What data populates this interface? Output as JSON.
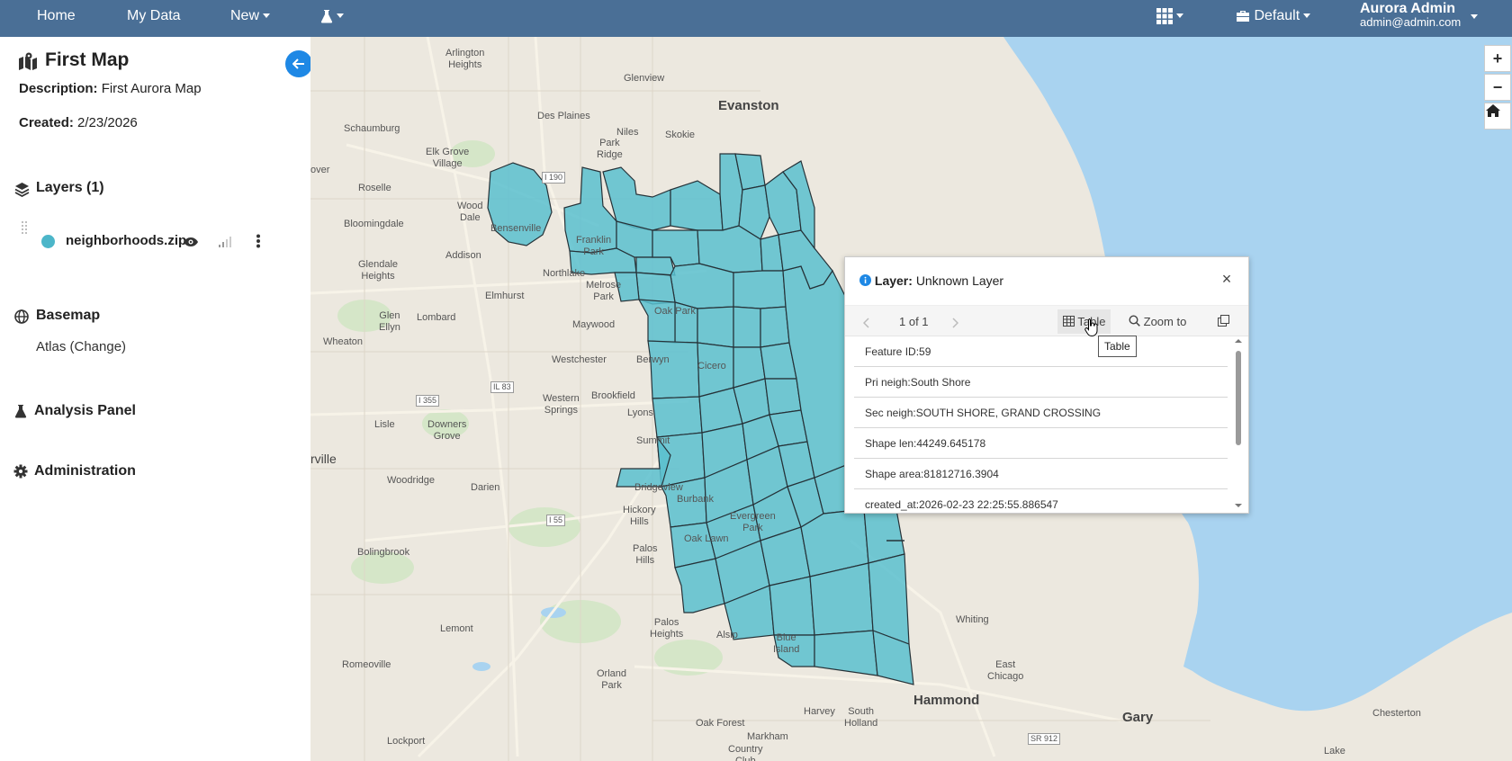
{
  "nav": {
    "home": "Home",
    "my_data": "My Data",
    "new": "New",
    "workspace": "Default",
    "user_name": "Aurora Admin",
    "user_email": "admin@admin.com"
  },
  "sidebar": {
    "map_title": "First Map",
    "description_label": "Description:",
    "description_value": "First Aurora Map",
    "created_label": "Created:",
    "created_value": "2/23/2026",
    "layers_title": "Layers (1)",
    "layer_name": "neighborhoods.zip",
    "basemap_title": "Basemap",
    "basemap_value": "Atlas (Change)",
    "analysis_title": "Analysis Panel",
    "admin_title": "Administration"
  },
  "colors": {
    "nav_bg": "#4a6f96",
    "accent": "#1e88e5",
    "water": "#a9d3f0",
    "land": "#ece8df",
    "polygon_fill": "#5bbfcf",
    "layer_dot": "#4cb6c9"
  },
  "map_labels": {
    "arlington_heights": "Arlington\nHeights",
    "glenview": "Glenview",
    "evanston": "Evanston",
    "des_plaines": "Des Plaines",
    "niles": "Niles",
    "skokie": "Skokie",
    "park_ridge": "Park\nRidge",
    "schaumburg": "Schaumburg",
    "elk_grove_village": "Elk Grove\nVillage",
    "roselle": "Roselle",
    "wood_dale": "Wood\nDale",
    "bensenville": "Bensenville",
    "bloomingdale": "Bloomingdale",
    "franklin_park": "Franklin\nPark",
    "addison": "Addison",
    "glendale_heights": "Glendale\nHeights",
    "northlake": "Northlake",
    "elmhurst": "Elmhurst",
    "melrose_park": "Melrose\nPark",
    "glen_ellyn": "Glen\nEllyn",
    "lombard": "Lombard",
    "oak_park": "Oak Park",
    "maywood": "Maywood",
    "wheaton": "Wheaton",
    "westchester": "Westchester",
    "berwyn": "Berwyn",
    "cicero": "Cicero",
    "western_springs": "Western\nSprings",
    "brookfield": "Brookfield",
    "lisle": "Lisle",
    "downers_grove": "Downers\nGrove",
    "lyons": "Lyons",
    "summit": "Summit",
    "naperville": "rville",
    "woodridge": "Woodridge",
    "darien": "Darien",
    "bridgeview": "Bridgeview",
    "burbank": "Burbank",
    "hickory_hills": "Hickory\nHills",
    "evergreen_park": "Evergreen\nPark",
    "bolingbrook": "Bolingbrook",
    "oak_lawn": "Oak Lawn",
    "palos_hills": "Palos\nHills",
    "lemont": "Lemont",
    "palos_heights": "Palos\nHeights",
    "alsip": "Alsip",
    "blue_island": "Blue\nIsland",
    "romeoville": "Romeoville",
    "orland_park": "Orland\nPark",
    "whiting": "Whiting",
    "east_chicago": "East\nChicago",
    "hammond": "Hammond",
    "harvey": "Harvey",
    "south_holland": "South\nHolland",
    "oak_forest": "Oak Forest",
    "markham": "Markham",
    "country_club": "Country\nClub",
    "lockport": "Lockport",
    "gary": "Gary",
    "chesterton": "Chesterton",
    "lake": "Lake",
    "over": "over",
    "route_i355": "I 355",
    "route_il83": "IL 83",
    "route_i55": "I 55",
    "route_i190": "I 190",
    "route_sr912": "SR 912"
  },
  "popup": {
    "layer_label": "Layer:",
    "layer_value": "Unknown Layer",
    "pager": "1 of 1",
    "table_label": "Table",
    "zoom_label": "Zoom to",
    "tooltip": "Table",
    "rows": [
      "Feature ID:59",
      "Pri neigh:South Shore",
      "Sec neigh:SOUTH SHORE, GRAND CROSSING",
      "Shape len:44249.645178",
      "Shape area:81812716.3904",
      "created_at:2026-02-23 22:25:55.886547"
    ]
  },
  "icons": {
    "map_title_icon": "map-marked-icon",
    "layers_icon": "layer-group-icon",
    "basemap_icon": "globe-icon",
    "analysis_icon": "flask-icon",
    "admin_icon": "gear-icon",
    "nav_lab": "flask-icon",
    "nav_apps": "grid-icon",
    "nav_workspace": "briefcase-icon"
  }
}
